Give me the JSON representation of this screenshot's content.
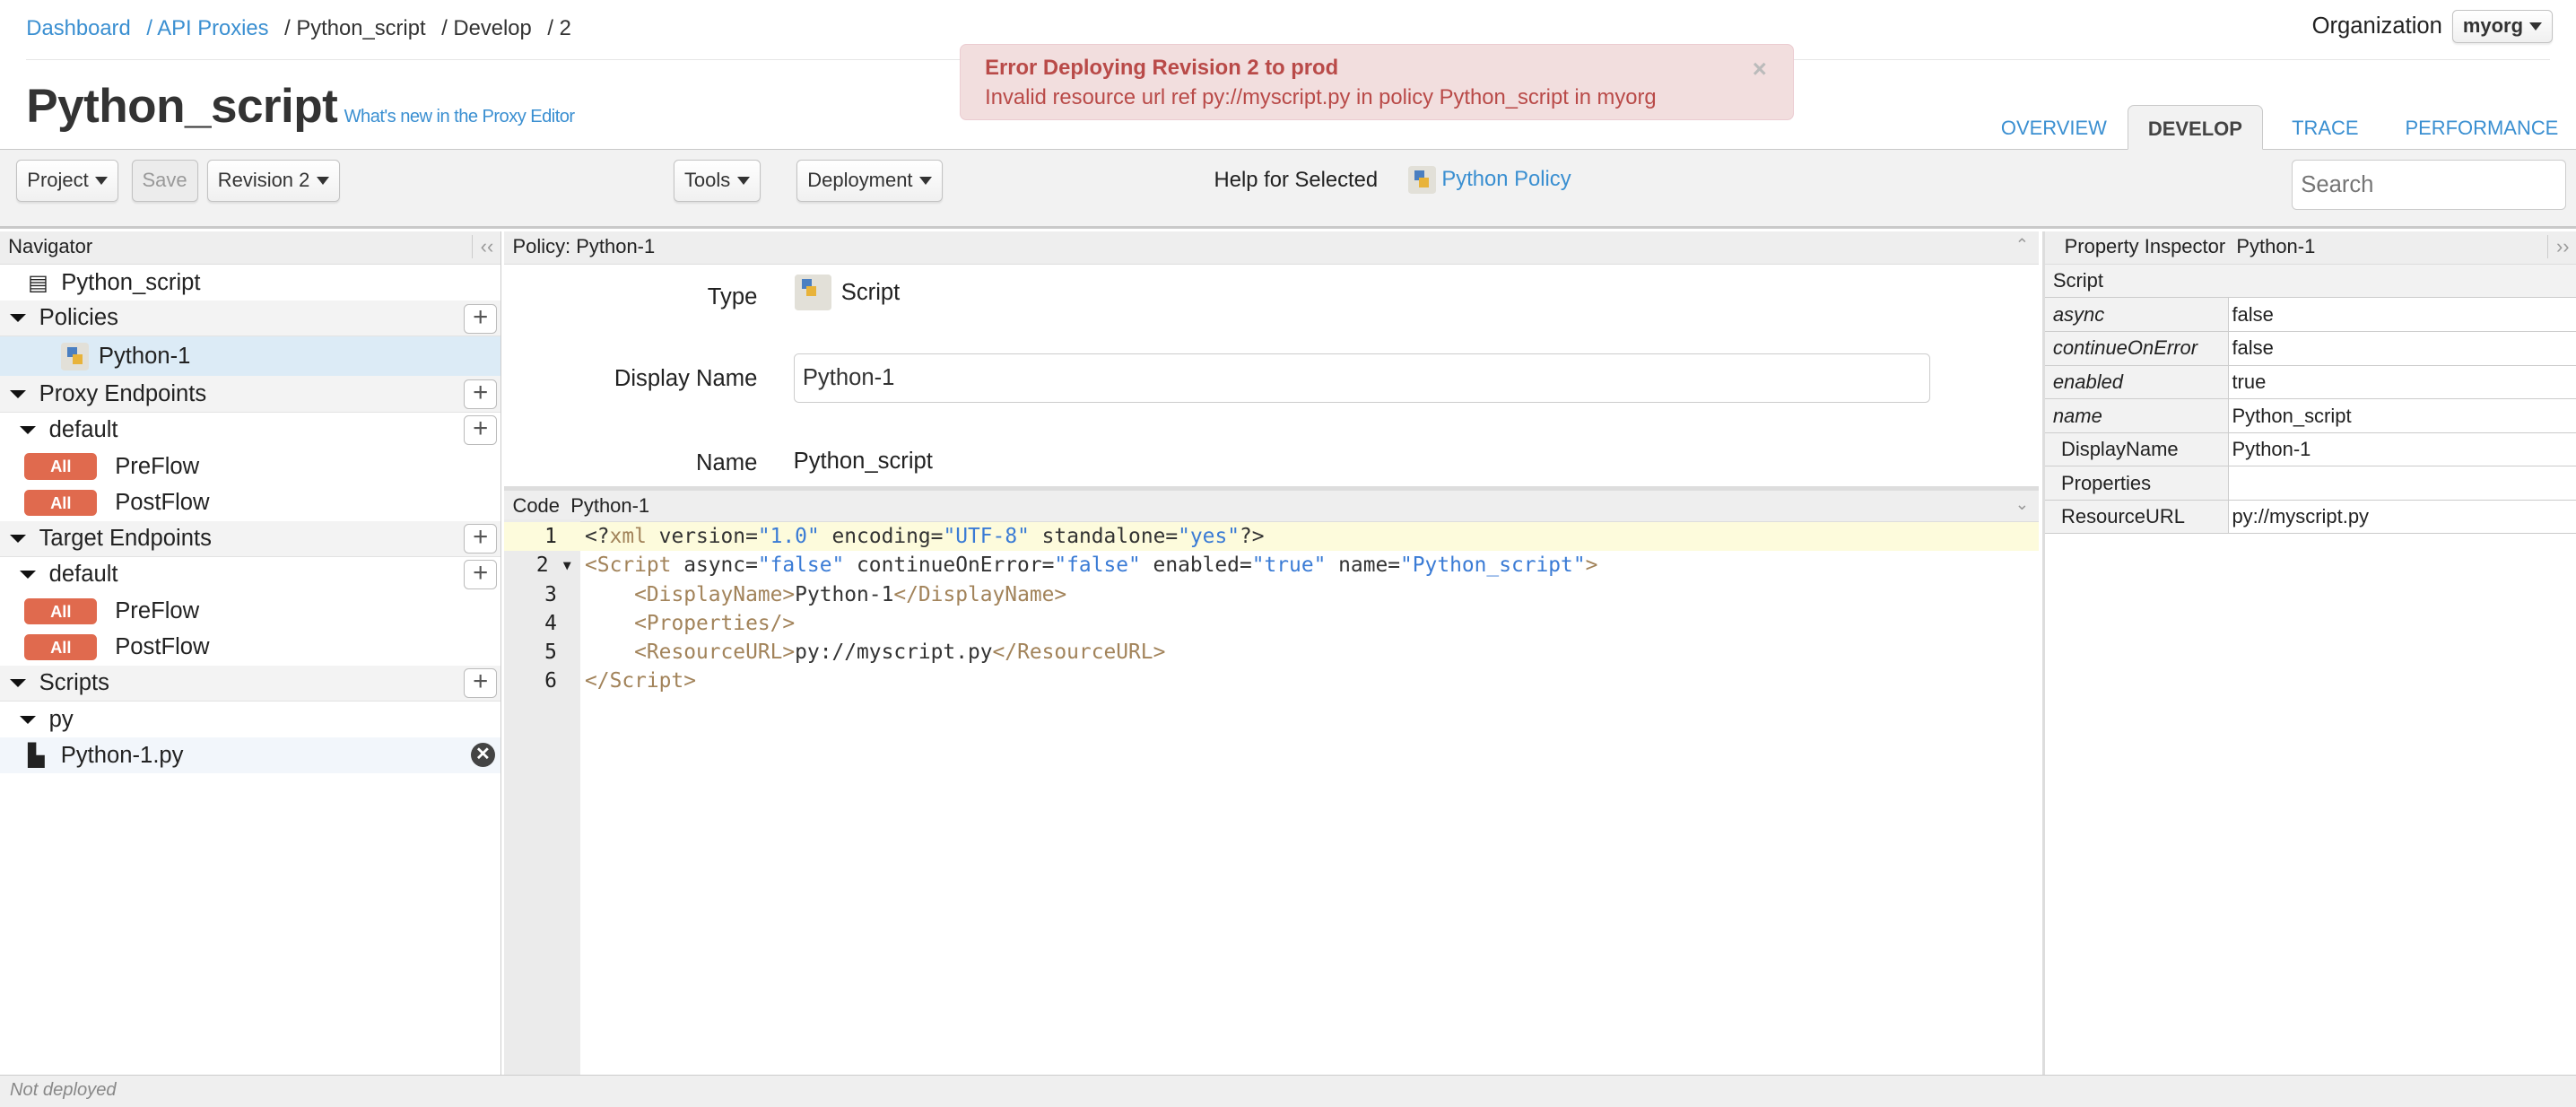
{
  "breadcrumb": [
    "Dashboard",
    "/ API Proxies",
    "/ Python_script",
    "/ Develop",
    "/ 2"
  ],
  "org": {
    "label": "Organization",
    "value": "myorg"
  },
  "title": "Python_script",
  "whats_new": "What's new in the Proxy Editor",
  "alert": {
    "title": "Error Deploying Revision 2 to prod",
    "message": "Invalid resource url ref py://myscript.py in policy Python_script in myorg",
    "close": "×"
  },
  "tabs": [
    "OVERVIEW",
    "DEVELOP",
    "TRACE",
    "PERFORMANCE"
  ],
  "toolbar": {
    "project": "Project",
    "save": "Save",
    "revision": "Revision 2",
    "tools": "Tools",
    "deployment": "Deployment",
    "help_label": "Help for Selected",
    "help_link": "Python Policy",
    "search_placeholder": "Search"
  },
  "navigator": {
    "title": "Navigator",
    "collapse": "‹‹",
    "proxy": "Python_script",
    "policies": "Policies",
    "policy_item": "Python-1",
    "proxy_endpoints": "Proxy Endpoints",
    "target_endpoints": "Target Endpoints",
    "default": "default",
    "all": "All",
    "preflow": "PreFlow",
    "postflow": "PostFlow",
    "scripts": "Scripts",
    "py": "py",
    "script_file": "Python-1.py"
  },
  "policy": {
    "header": "Policy: Python-1",
    "type_label": "Type",
    "type_value": "Script",
    "display_name_label": "Display Name",
    "display_name_value": "Python-1",
    "name_label": "Name",
    "name_value": "Python_script"
  },
  "code": {
    "label": "Code",
    "name": "Python-1",
    "lines": [
      [
        [
          "p",
          "<?"
        ],
        [
          "t",
          "xml"
        ],
        [
          "p",
          " version="
        ],
        [
          "s",
          "\"1.0\""
        ],
        [
          "p",
          " encoding="
        ],
        [
          "s",
          "\"UTF-8\""
        ],
        [
          "p",
          " standalone="
        ],
        [
          "s",
          "\"yes\""
        ],
        [
          "p",
          "?>"
        ]
      ],
      [
        [
          "t",
          "<Script"
        ],
        [
          "p",
          " async="
        ],
        [
          "s",
          "\"false\""
        ],
        [
          "p",
          " continueOnError="
        ],
        [
          "s",
          "\"false\""
        ],
        [
          "p",
          " enabled="
        ],
        [
          "s",
          "\"true\""
        ],
        [
          "p",
          " name="
        ],
        [
          "s",
          "\"Python_script\""
        ],
        [
          "t",
          ">"
        ]
      ],
      [
        [
          "p",
          "    "
        ],
        [
          "t",
          "<DisplayName>"
        ],
        [
          "p",
          "Python-1"
        ],
        [
          "t",
          "</DisplayName>"
        ]
      ],
      [
        [
          "p",
          "    "
        ],
        [
          "t",
          "<Properties/>"
        ]
      ],
      [
        [
          "p",
          "    "
        ],
        [
          "t",
          "<ResourceURL>"
        ],
        [
          "p",
          "py://myscript.py"
        ],
        [
          "t",
          "</ResourceURL>"
        ]
      ],
      [
        [
          "t",
          "</Script>"
        ]
      ]
    ]
  },
  "inspector": {
    "title": "Property Inspector",
    "name": "Python-1",
    "expand": "››",
    "section": "Script",
    "rows": [
      {
        "key": "async",
        "value": "false",
        "italic": true
      },
      {
        "key": "continueOnError",
        "value": "false",
        "italic": true
      },
      {
        "key": "enabled",
        "value": "true",
        "italic": true
      },
      {
        "key": "name",
        "value": "Python_script",
        "italic": true
      },
      {
        "key": "DisplayName",
        "value": "Python-1",
        "italic": false
      },
      {
        "key": "Properties",
        "value": "",
        "italic": false
      },
      {
        "key": "ResourceURL",
        "value": "py://myscript.py",
        "italic": false
      }
    ]
  },
  "status": "Not deployed"
}
